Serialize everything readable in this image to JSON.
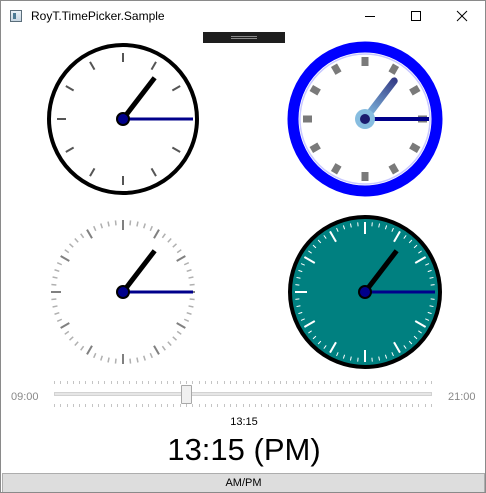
{
  "window": {
    "title": "RoyT.TimePicker.Sample",
    "minimize_icon": "minimize-icon",
    "maximize_icon": "maximize-icon",
    "close_icon": "close-icon"
  },
  "time": {
    "hour": 13,
    "minute": 15
  },
  "slider": {
    "min_label": "09:00",
    "max_label": "21:00",
    "value_fraction": 0.35
  },
  "display": {
    "small_time": "13:15",
    "big_time": "13:15 (PM)"
  },
  "ampm_button_label": "AM/PM",
  "colors": {
    "minute_hand": "#00008b",
    "hour_hand": "#000000",
    "blue_rim": "#0000ff",
    "teal_face": "#008080"
  }
}
